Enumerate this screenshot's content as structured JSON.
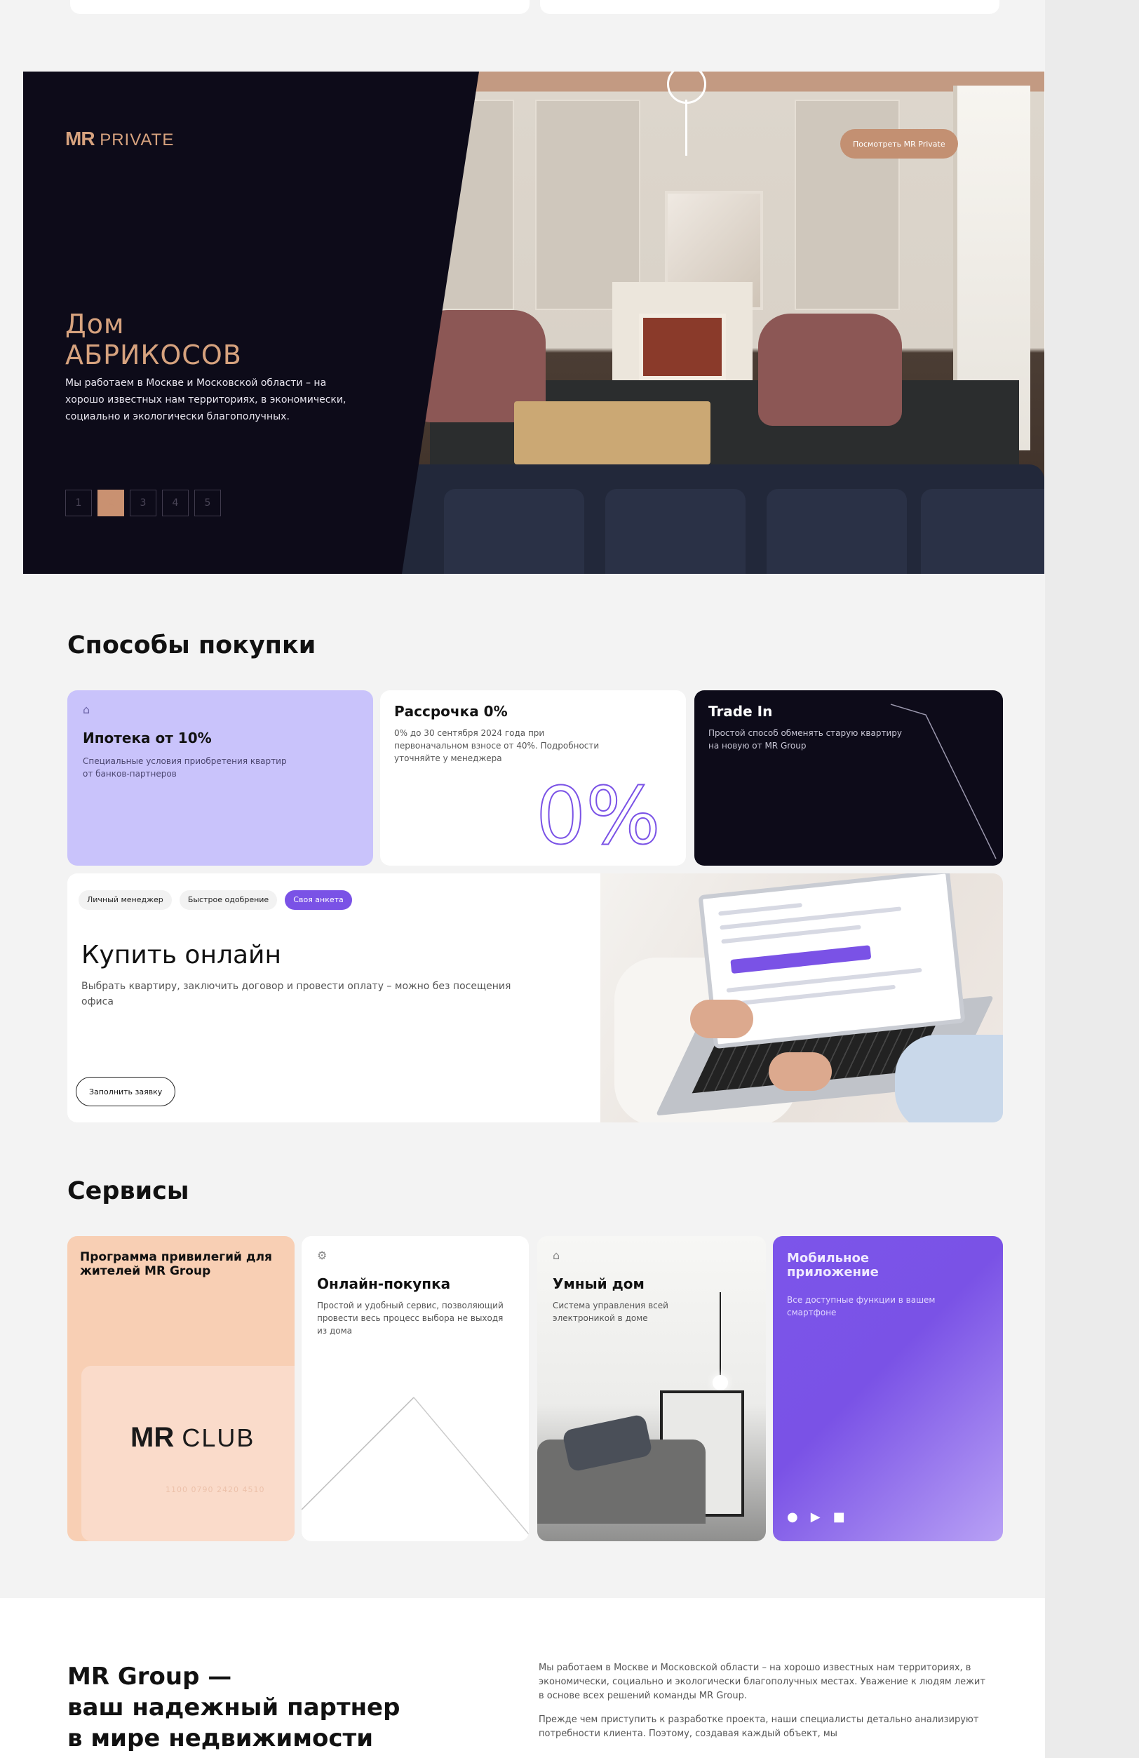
{
  "hero": {
    "brand_mark": "MR",
    "brand_word": "PRIVATE",
    "title_line1": "Дом",
    "title_line2": "АБРИКОСОВ",
    "text": "Мы работаем в Москве и Московской области – на хорошо известных нам территориях, в экономически, социально и экологически благополучных.",
    "pages": [
      "1",
      "2",
      "3",
      "4",
      "5"
    ],
    "active_page": 2,
    "button_label": "Посмотреть MR Private"
  },
  "purchase": {
    "title": "Способы покупки",
    "mortgage": {
      "icon": "bag-icon",
      "title": "Ипотека от 10%",
      "text": "Специальные условия приобретения квартир от банков-партнеров"
    },
    "installment": {
      "title": "Рассрочка 0%",
      "text": "0% до 30 сентября 2024 года при первоначальном взносе от 40%. Подробности уточняйте у менеджера",
      "big": "0%"
    },
    "tradein": {
      "title": "Trade In",
      "text": "Простой способ обменять старую квартиру на новую от MR Group"
    },
    "online": {
      "chips": [
        "Личный менеджер",
        "Быстрое одобрение",
        "Своя анкета"
      ],
      "title": "Купить онлайн",
      "text": "Выбрать квартиру, заключить договор и провести оплату – можно без посещения офиса",
      "button_label": "Заполнить заявку"
    }
  },
  "services": {
    "title": "Сервисы",
    "club": {
      "title": "Программа привилегий для жителей MR Group",
      "logo_mark": "MR",
      "logo_word": "CLUB",
      "card_number": "1100 0790 2420 4510"
    },
    "online_buy": {
      "icon": "gear-icon",
      "title": "Онлайн-покупка",
      "text": "Простой и удобный сервис, позволяющий провести весь процесс выбора не выходя из дома"
    },
    "smart_home": {
      "icon": "home-icon",
      "title": "Умный дом",
      "text": "Система управления всей электроникой в доме"
    },
    "mobile_app": {
      "title": "Мобильное приложение",
      "text": "Все доступные функции в вашем смартфоне",
      "stores": [
        "apple-icon",
        "google-play-icon",
        "appgallery-icon"
      ]
    }
  },
  "about": {
    "title_line1": "MR Group —",
    "title_line2": "ваш надежный партнер",
    "title_line3": "в мире недвижимости",
    "p1": "Мы работаем в Москве и Московской области – на хорошо известных нам территориях, в экономически, социально и экологически благополучных местах. Уважение к людям лежит в основе всех решений команды MR Group.",
    "p2": "Прежде чем приступить к разработке проекта, наши специалисты детально анализируют потребности клиента. Поэтому, создавая каждый объект, мы"
  },
  "colors": {
    "hero_bg": "#0d0b19",
    "accent_copper": "#d6a27e",
    "accent_purple": "#7a52e6",
    "lavender": "#c9c3fb",
    "peach": "#f8cfb4"
  }
}
